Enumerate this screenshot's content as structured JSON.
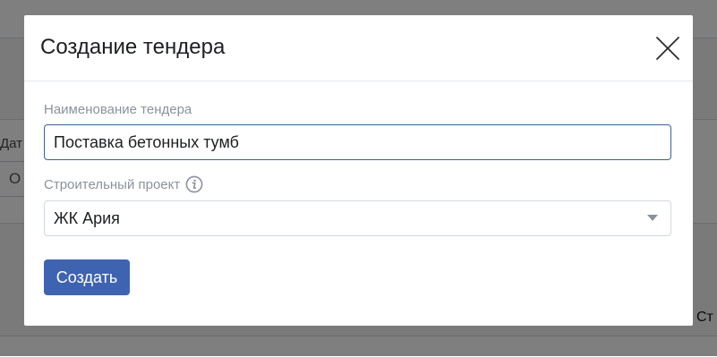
{
  "background": {
    "field_label_fragment": "Дат",
    "field_value_fragment": "О",
    "column_header_fragment": "Ст"
  },
  "modal": {
    "title": "Создание тендера",
    "close_icon": "close-icon",
    "name_field": {
      "label": "Наименование тендера",
      "value": "Поставка бетонных тумб"
    },
    "project_field": {
      "label": "Строительный проект",
      "info_icon": "info-icon",
      "selected_value": "ЖК Ария"
    },
    "submit_label": "Создать"
  },
  "colors": {
    "primary_button": "#3e63b0",
    "input_focus_border": "#3e5f96",
    "label_text": "#8b929d"
  }
}
